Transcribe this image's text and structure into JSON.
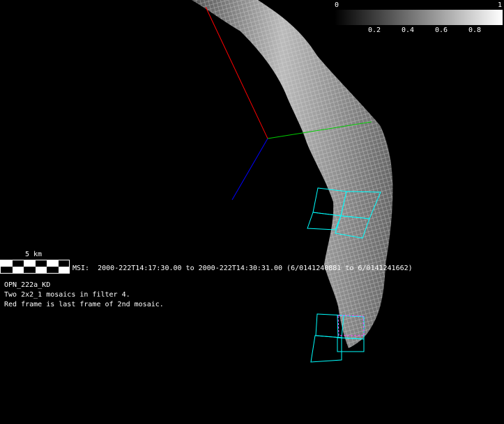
{
  "colorbar": {
    "min_label": "0",
    "max_label": "1",
    "ticks": [
      "0.2",
      "0.4",
      "0.6",
      "0.8"
    ],
    "colors": [
      "#000000",
      "#ffffff"
    ]
  },
  "scale_bar": {
    "label": "5 km"
  },
  "observation": {
    "line": "MSI:  2000-222T14:17:30.00 to 2000-222T14:30:31.00 (6/0141240881 to 6/0141241662)"
  },
  "info": {
    "id": "OPN_222a_KD",
    "line1": "Two 2x2_1 mosaics in filter 4.",
    "line2": "Red frame is last frame of 2nd mosaic."
  },
  "axes_colors": {
    "x": "#ff0000",
    "y": "#00cc00",
    "z": "#0000ff"
  },
  "footprint_colors": {
    "mosaic": "#00ffff",
    "last_frame": "#ff44ff"
  }
}
